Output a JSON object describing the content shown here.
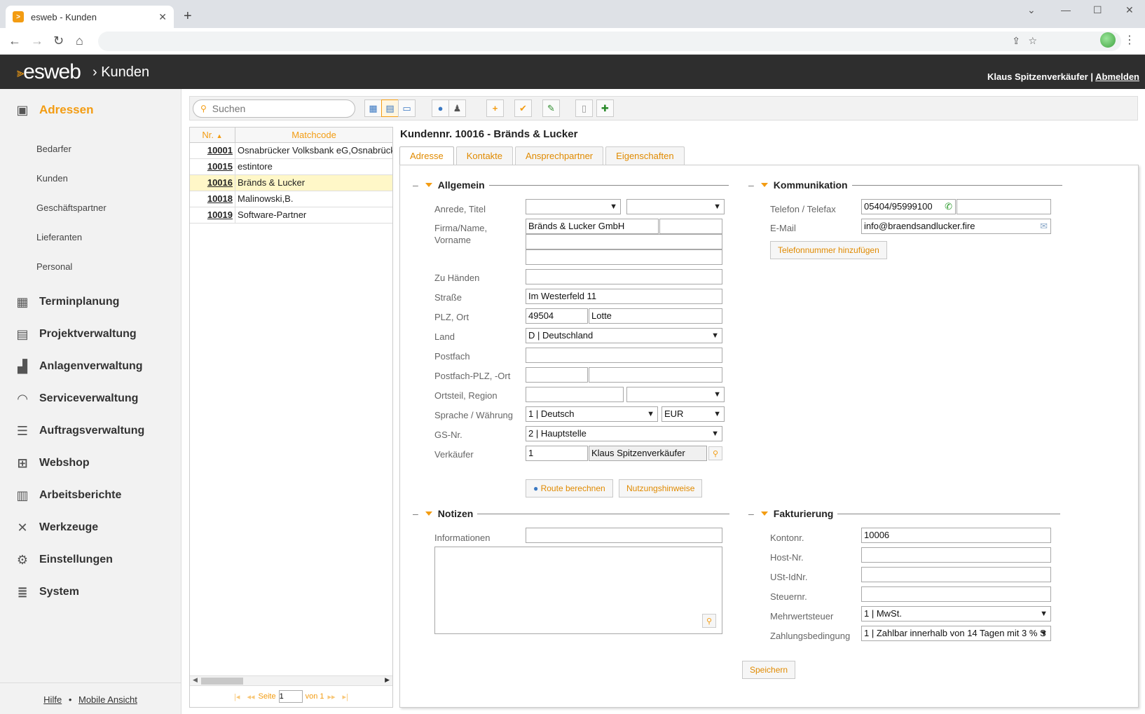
{
  "browser": {
    "tab_title": "esweb - Kunden",
    "tab_favicon": "esweb-favicon-icon",
    "new_tab": "+",
    "minimize": "—",
    "maximize": "☐",
    "close": "✕",
    "caret": "⌄"
  },
  "app": {
    "logo": "esweb",
    "breadcrumb": "Kunden",
    "user": "Klaus Spitzenverkäufer",
    "separator": "|",
    "logout": "Abmelden"
  },
  "sidebar": {
    "active": "Adressen",
    "subitems": [
      "Bedarfer",
      "Kunden",
      "Geschäftspartner",
      "Lieferanten",
      "Personal"
    ],
    "items": [
      {
        "label": "Terminplanung",
        "icon": "calendar-icon"
      },
      {
        "label": "Projektverwaltung",
        "icon": "gantt-icon"
      },
      {
        "label": "Anlagenverwaltung",
        "icon": "factory-icon"
      },
      {
        "label": "Serviceverwaltung",
        "icon": "headset-icon"
      },
      {
        "label": "Auftragsverwaltung",
        "icon": "list-icon"
      },
      {
        "label": "Webshop",
        "icon": "cart-icon"
      },
      {
        "label": "Arbeitsberichte",
        "icon": "clipboard-icon"
      },
      {
        "label": "Werkzeuge",
        "icon": "tools-icon"
      },
      {
        "label": "Einstellungen",
        "icon": "gears-icon"
      },
      {
        "label": "System",
        "icon": "database-icon"
      }
    ],
    "footer": {
      "help": "Hilfe",
      "dot": "•",
      "mobile": "Mobile Ansicht"
    }
  },
  "toolbar": {
    "search_placeholder": "Suchen"
  },
  "list": {
    "col_nr": "Nr.",
    "col_match": "Matchcode",
    "rows": [
      {
        "nr": "10001",
        "match": "Osnabrücker Volksbank eG,Osnabrück"
      },
      {
        "nr": "10015",
        "match": "estintore"
      },
      {
        "nr": "10016",
        "match": "Bränds & Lucker"
      },
      {
        "nr": "10018",
        "match": "Malinowski,B."
      },
      {
        "nr": "10019",
        "match": "Software-Partner"
      }
    ],
    "pager": {
      "page_label": "Seite",
      "page": "1",
      "of_label": "von 1"
    }
  },
  "detail": {
    "title": "Kundennr. 10016 - Bränds & Lucker",
    "tabs": [
      "Adresse",
      "Kontakte",
      "Ansprechpartner",
      "Eigenschaften"
    ],
    "allgemein": {
      "title": "Allgemein",
      "anrede_label": "Anrede, Titel",
      "firma_label": "Firma/Name,",
      "vorname_label": "Vorname",
      "firma_value": "Bränds & Lucker GmbH",
      "zuhaenden_label": "Zu Händen",
      "strasse_label": "Straße",
      "strasse_value": "Im Westerfeld 11",
      "plzort_label": "PLZ, Ort",
      "plz_value": "49504",
      "ort_value": "Lotte",
      "land_label": "Land",
      "land_value": "D | Deutschland",
      "postfach_label": "Postfach",
      "postfachplz_label": "Postfach-PLZ, -Ort",
      "ortsteil_label": "Ortsteil, Region",
      "sprache_label": "Sprache / Währung",
      "sprache_value": "1 | Deutsch",
      "waehrung_value": "EUR",
      "gs_label": "GS-Nr.",
      "gs_value": "2 | Hauptstelle",
      "verk_label": "Verkäufer",
      "verk_nr": "1",
      "verk_name": "Klaus Spitzenverkäufer",
      "route_btn": "Route berechnen",
      "hinweise_btn": "Nutzungshinweise"
    },
    "kommunikation": {
      "title": "Kommunikation",
      "tel_label": "Telefon / Telefax",
      "tel_value": "05404/95999100",
      "email_label": "E-Mail",
      "email_value": "info@braendsandlucker.fire",
      "add_phone_btn": "Telefonnummer hinzufügen"
    },
    "notizen": {
      "title": "Notizen",
      "info_label": "Informationen"
    },
    "fakturierung": {
      "title": "Fakturierung",
      "konto_label": "Kontonr.",
      "konto_value": "10006",
      "host_label": "Host-Nr.",
      "ust_label": "USt-IdNr.",
      "steuer_label": "Steuernr.",
      "mwst_label": "Mehrwertsteuer",
      "mwst_value": "1 | MwSt.",
      "zahl_label": "Zahlungsbedingung",
      "zahl_value": "1 | Zahlbar innerhalb von 14 Tagen mit 3 % S"
    },
    "save_btn": "Speichern"
  }
}
